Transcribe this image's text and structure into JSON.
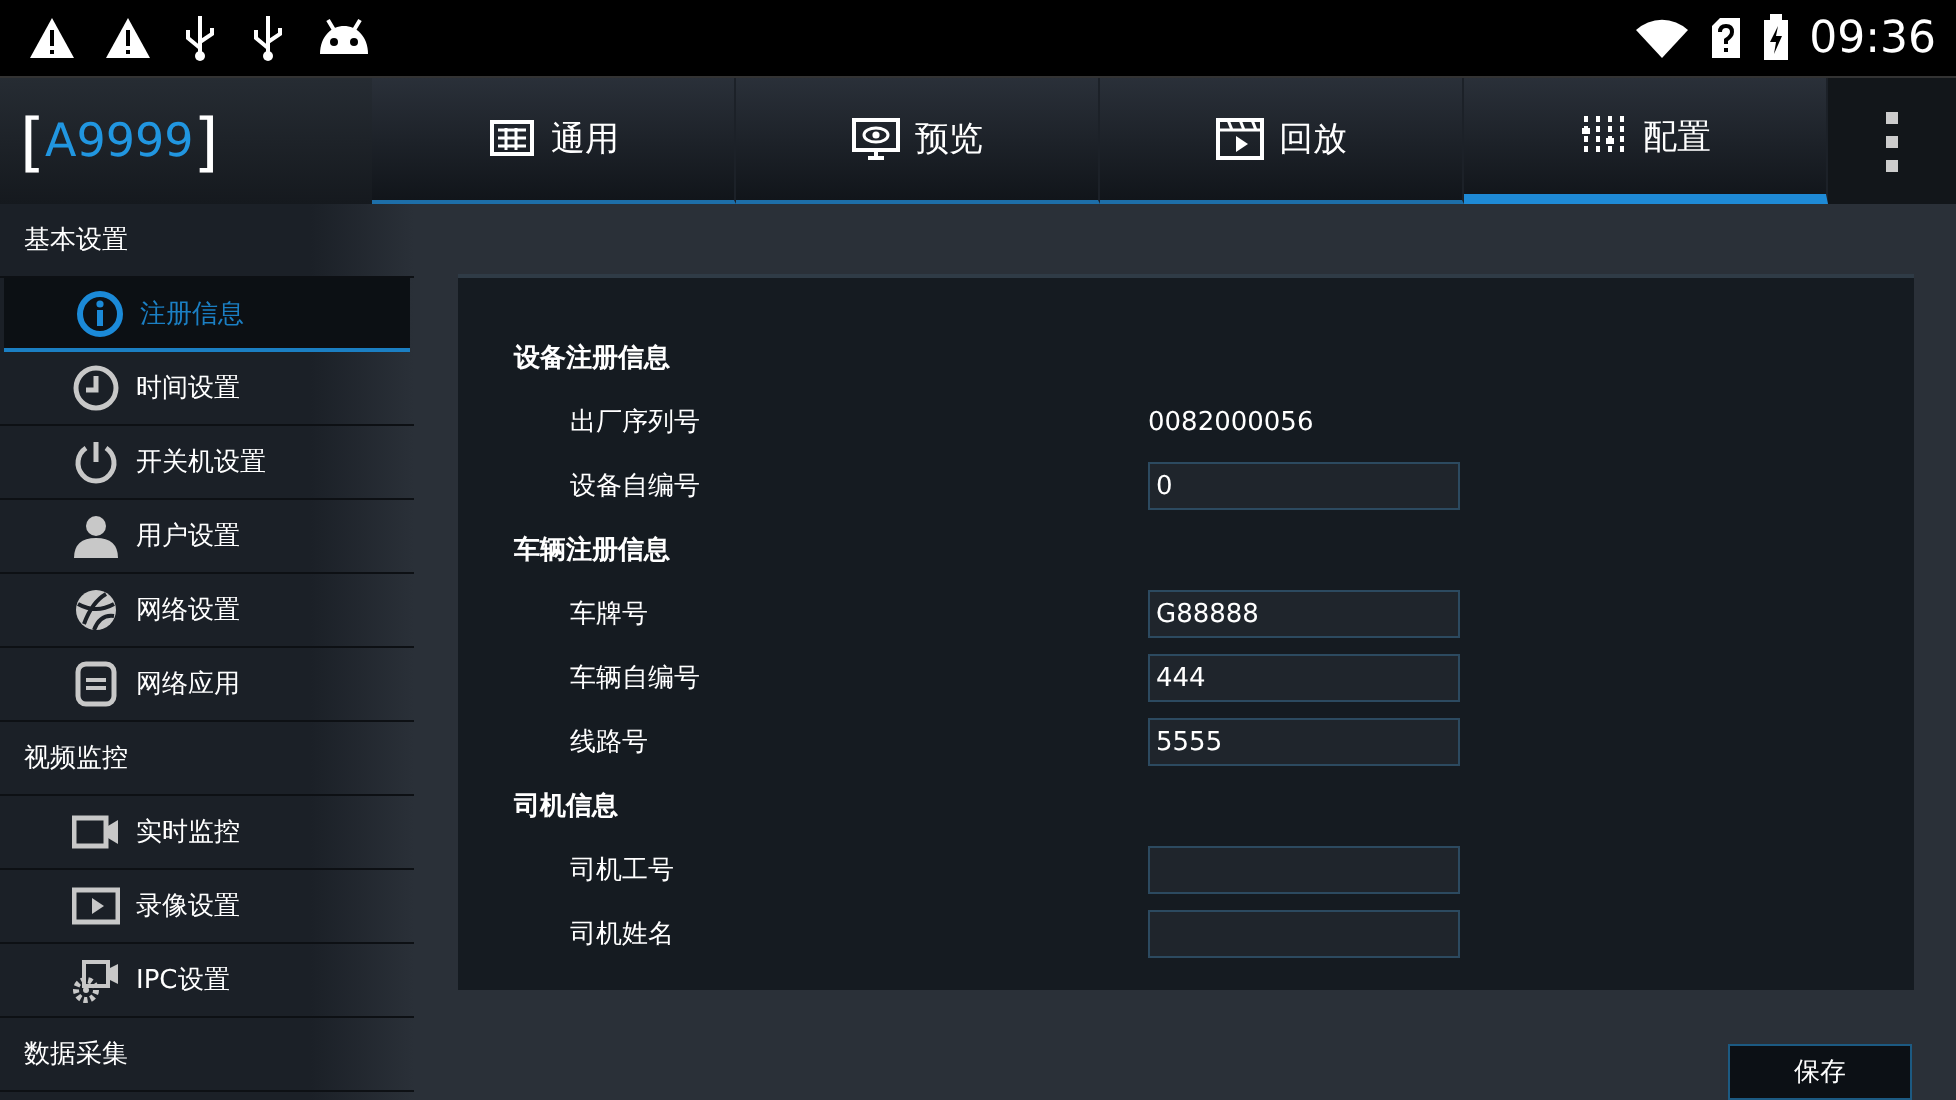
{
  "status_bar": {
    "time": "09:36"
  },
  "logo": {
    "open": "[",
    "text": "A9999",
    "close": "]"
  },
  "tabs": [
    {
      "label": "通用",
      "selected": false
    },
    {
      "label": "预览",
      "selected": false
    },
    {
      "label": "回放",
      "selected": false
    },
    {
      "label": "配置",
      "selected": true
    }
  ],
  "sidebar": [
    {
      "title": "基本设置",
      "items": [
        {
          "label": "注册信息",
          "selected": true
        },
        {
          "label": "时间设置",
          "selected": false
        },
        {
          "label": "开关机设置",
          "selected": false
        },
        {
          "label": "用户设置",
          "selected": false
        },
        {
          "label": "网络设置",
          "selected": false
        },
        {
          "label": "网络应用",
          "selected": false
        }
      ]
    },
    {
      "title": "视频监控",
      "items": [
        {
          "label": "实时监控",
          "selected": false
        },
        {
          "label": "录像设置",
          "selected": false
        },
        {
          "label": "IPC设置",
          "selected": false
        }
      ]
    },
    {
      "title": "数据采集"
    }
  ],
  "form": [
    {
      "title": "设备注册信息",
      "rows": [
        {
          "label": "出厂序列号",
          "kind": "text",
          "value": "0082000056"
        },
        {
          "label": "设备自编号",
          "kind": "input",
          "value": "0"
        }
      ]
    },
    {
      "title": "车辆注册信息",
      "rows": [
        {
          "label": "车牌号",
          "kind": "input",
          "value": "G88888"
        },
        {
          "label": "车辆自编号",
          "kind": "input",
          "value": "444"
        },
        {
          "label": "线路号",
          "kind": "input",
          "value": "5555"
        }
      ]
    },
    {
      "title": "司机信息",
      "rows": [
        {
          "label": "司机工号",
          "kind": "input"
        },
        {
          "label": "司机姓名",
          "kind": "input"
        }
      ]
    }
  ],
  "save_button": "保存"
}
